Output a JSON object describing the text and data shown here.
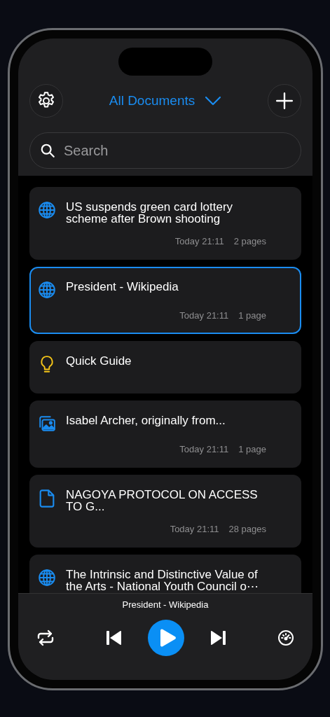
{
  "header": {
    "title": "All Documents"
  },
  "search": {
    "placeholder": "Search"
  },
  "documents": [
    {
      "kind": "web",
      "title": "US suspends green card lottery scheme after Brown shooting",
      "date": "Today 21:11",
      "pages": "2 pages",
      "selected": false
    },
    {
      "kind": "web",
      "title": "President - Wikipedia",
      "date": "Today 21:11",
      "pages": "1 page",
      "selected": true
    },
    {
      "kind": "guide",
      "title": "Quick Guide",
      "selected": false
    },
    {
      "kind": "images",
      "title": "Isabel Archer, originally from...",
      "date": "Today 21:11",
      "pages": "1 page",
      "selected": false
    },
    {
      "kind": "document",
      "title": "NAGOYA PROTOCOL ON ACCESS TO G...",
      "date": "Today 21:11",
      "pages": "28 pages",
      "selected": false
    },
    {
      "kind": "web",
      "title": "The Intrinsic and Distinctive Value of the Arts - National Youth Council o⋯",
      "selected": false
    }
  ],
  "player": {
    "title": "President - Wikipedia"
  }
}
